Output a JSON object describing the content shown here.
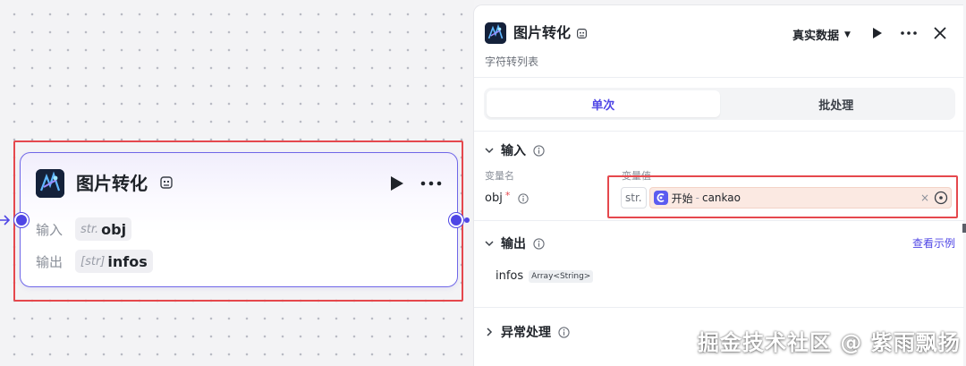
{
  "node": {
    "title": "图片转化",
    "inputs_label": "输入",
    "outputs_label": "输出",
    "input_type": "str.",
    "input_name": "obj",
    "output_type": "[str]",
    "output_name": "infos"
  },
  "panel": {
    "title": "图片转化",
    "subtitle": "字符转列表",
    "data_mode": "真实数据",
    "tabs": [
      {
        "label": "单次",
        "active": true
      },
      {
        "label": "批处理",
        "active": false
      }
    ],
    "input_section": {
      "title": "输入",
      "col_name": "变量名",
      "col_value": "变量值",
      "var_name": "obj",
      "required_mark": "*",
      "value_type": "str.",
      "ref_source": "开始",
      "ref_sep": "-",
      "ref_var": "cankao",
      "clear_glyph": "×"
    },
    "output_section": {
      "title": "输出",
      "view_example": "查看示例",
      "out_name": "infos",
      "out_type": "Array<String>"
    },
    "error_section": {
      "title": "异常处理"
    }
  },
  "watermark": "掘金技术社区 @ 紫雨飘扬",
  "colors": {
    "accent": "#4f46e5",
    "highlight_red": "#e5484d",
    "ref_bg": "#fbe9e2"
  }
}
